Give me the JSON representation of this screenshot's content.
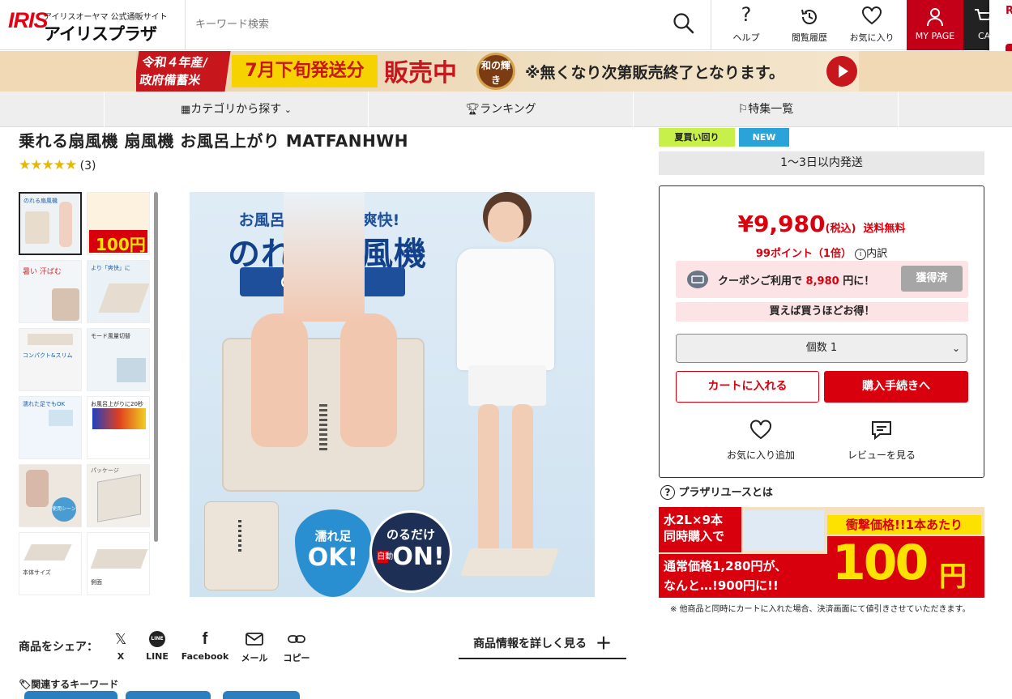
{
  "header": {
    "logo_brand": "IRIS",
    "logo_sub": "アイリスオーヤマ 公式通販サイト",
    "logo_main": "アイリスプラザ",
    "search_placeholder": "キーワード検索",
    "nav": [
      {
        "label": "ヘルプ",
        "icon": "question-icon"
      },
      {
        "label": "閲覧履歴",
        "icon": "history-icon"
      },
      {
        "label": "お気に入り",
        "icon": "heart-icon"
      },
      {
        "label": "MY PAGE",
        "icon": "person-icon"
      },
      {
        "label": "CA",
        "icon": "cart-icon"
      }
    ],
    "popup_letter": "R"
  },
  "banner": {
    "part1_line1": "令和４年産/",
    "part1_line2": "政府備蓄米",
    "part2": "7月下旬発送分",
    "part3": "販売中",
    "seal": "和の輝き",
    "part4": "※無くなり次第販売終了となります。",
    "accent": "#c8161d"
  },
  "category_nav": [
    {
      "label": "カテゴリから探す",
      "icon": "grid-icon"
    },
    {
      "label": "ランキング",
      "icon": "trophy-icon"
    },
    {
      "label": "特集一覧",
      "icon": "flag-icon"
    }
  ],
  "product": {
    "title": "乗れる扇風機 扇風機 お風呂上がり MATFANHWH",
    "stars": "★★★★★",
    "rating_value": 5,
    "review_count": "(3)"
  },
  "main_image": {
    "headline": "お風呂あがり全身爽快!",
    "title": "のれる扇風機",
    "subtitle": "のれせん２",
    "badge1_top": "濡れ足",
    "badge1_main": "OK!",
    "badge2_top": "のるだけ",
    "badge2_side": "自動",
    "badge2_main": "ON!"
  },
  "thumbnails": [
    {
      "label": "のれる扇風機"
    },
    {
      "label": "100円"
    },
    {
      "label": "暑い 汗ばむ"
    },
    {
      "label": "より「爽快」に"
    },
    {
      "label": "コンパクト&スリム"
    },
    {
      "label": "モード風量切替"
    },
    {
      "label": "濡れた足でもOK"
    },
    {
      "label": "お風呂上がりに20秒"
    },
    {
      "label": "使用シーン"
    },
    {
      "label": "パッケージ"
    },
    {
      "label": "本体サイズ"
    },
    {
      "label": "側面"
    }
  ],
  "tags": {
    "tag1": "夏買い回り",
    "tag2": "NEW",
    "tag1_color": "#c8f04a",
    "tag2_color": "#29a3d8"
  },
  "shipping": "1〜3日以内発送",
  "price": {
    "amount": "¥9,980",
    "tax": "(税込)",
    "shipping_free": "送料無料",
    "points": "99ポイント（1倍）",
    "points_detail": "内訳",
    "coupon_prefix": "クーポンご利用で",
    "coupon_price": "8,980",
    "coupon_suffix": "円に！",
    "coupon_button": "獲得済",
    "get_save": "買えば買うほどお得！",
    "quantity": "個数 1",
    "cart_button": "カートに入れる",
    "buy_button": "購入手続きへ",
    "favorite": "お気に入り追加",
    "review": "レビューを見る",
    "accent": "#d9000d"
  },
  "reuse": "プラザリユースとは",
  "promo": {
    "line1": "水2L×9本",
    "line2": "同時購入で",
    "line3": "衝撃価格!!1本あたり",
    "line4": "通常価格1,280円が、",
    "line5": "なんと…!900円に!!",
    "big": "100",
    "unit": "円"
  },
  "promo_note": "※ 他商品と同時にカートに入れた場合、決済画面にて値引きさせていただきます。",
  "share": {
    "label": "商品をシェア：",
    "items": [
      {
        "label": "X",
        "icon": "x-icon"
      },
      {
        "label": "LINE",
        "icon": "line-icon"
      },
      {
        "label": "Facebook",
        "icon": "facebook-icon"
      },
      {
        "label": "メール",
        "icon": "mail-icon"
      },
      {
        "label": "コピー",
        "icon": "link-icon"
      }
    ]
  },
  "more_info": "商品情報を詳しく見る",
  "more_info_icon": "＋",
  "keywords_label": "関連するキーワード"
}
